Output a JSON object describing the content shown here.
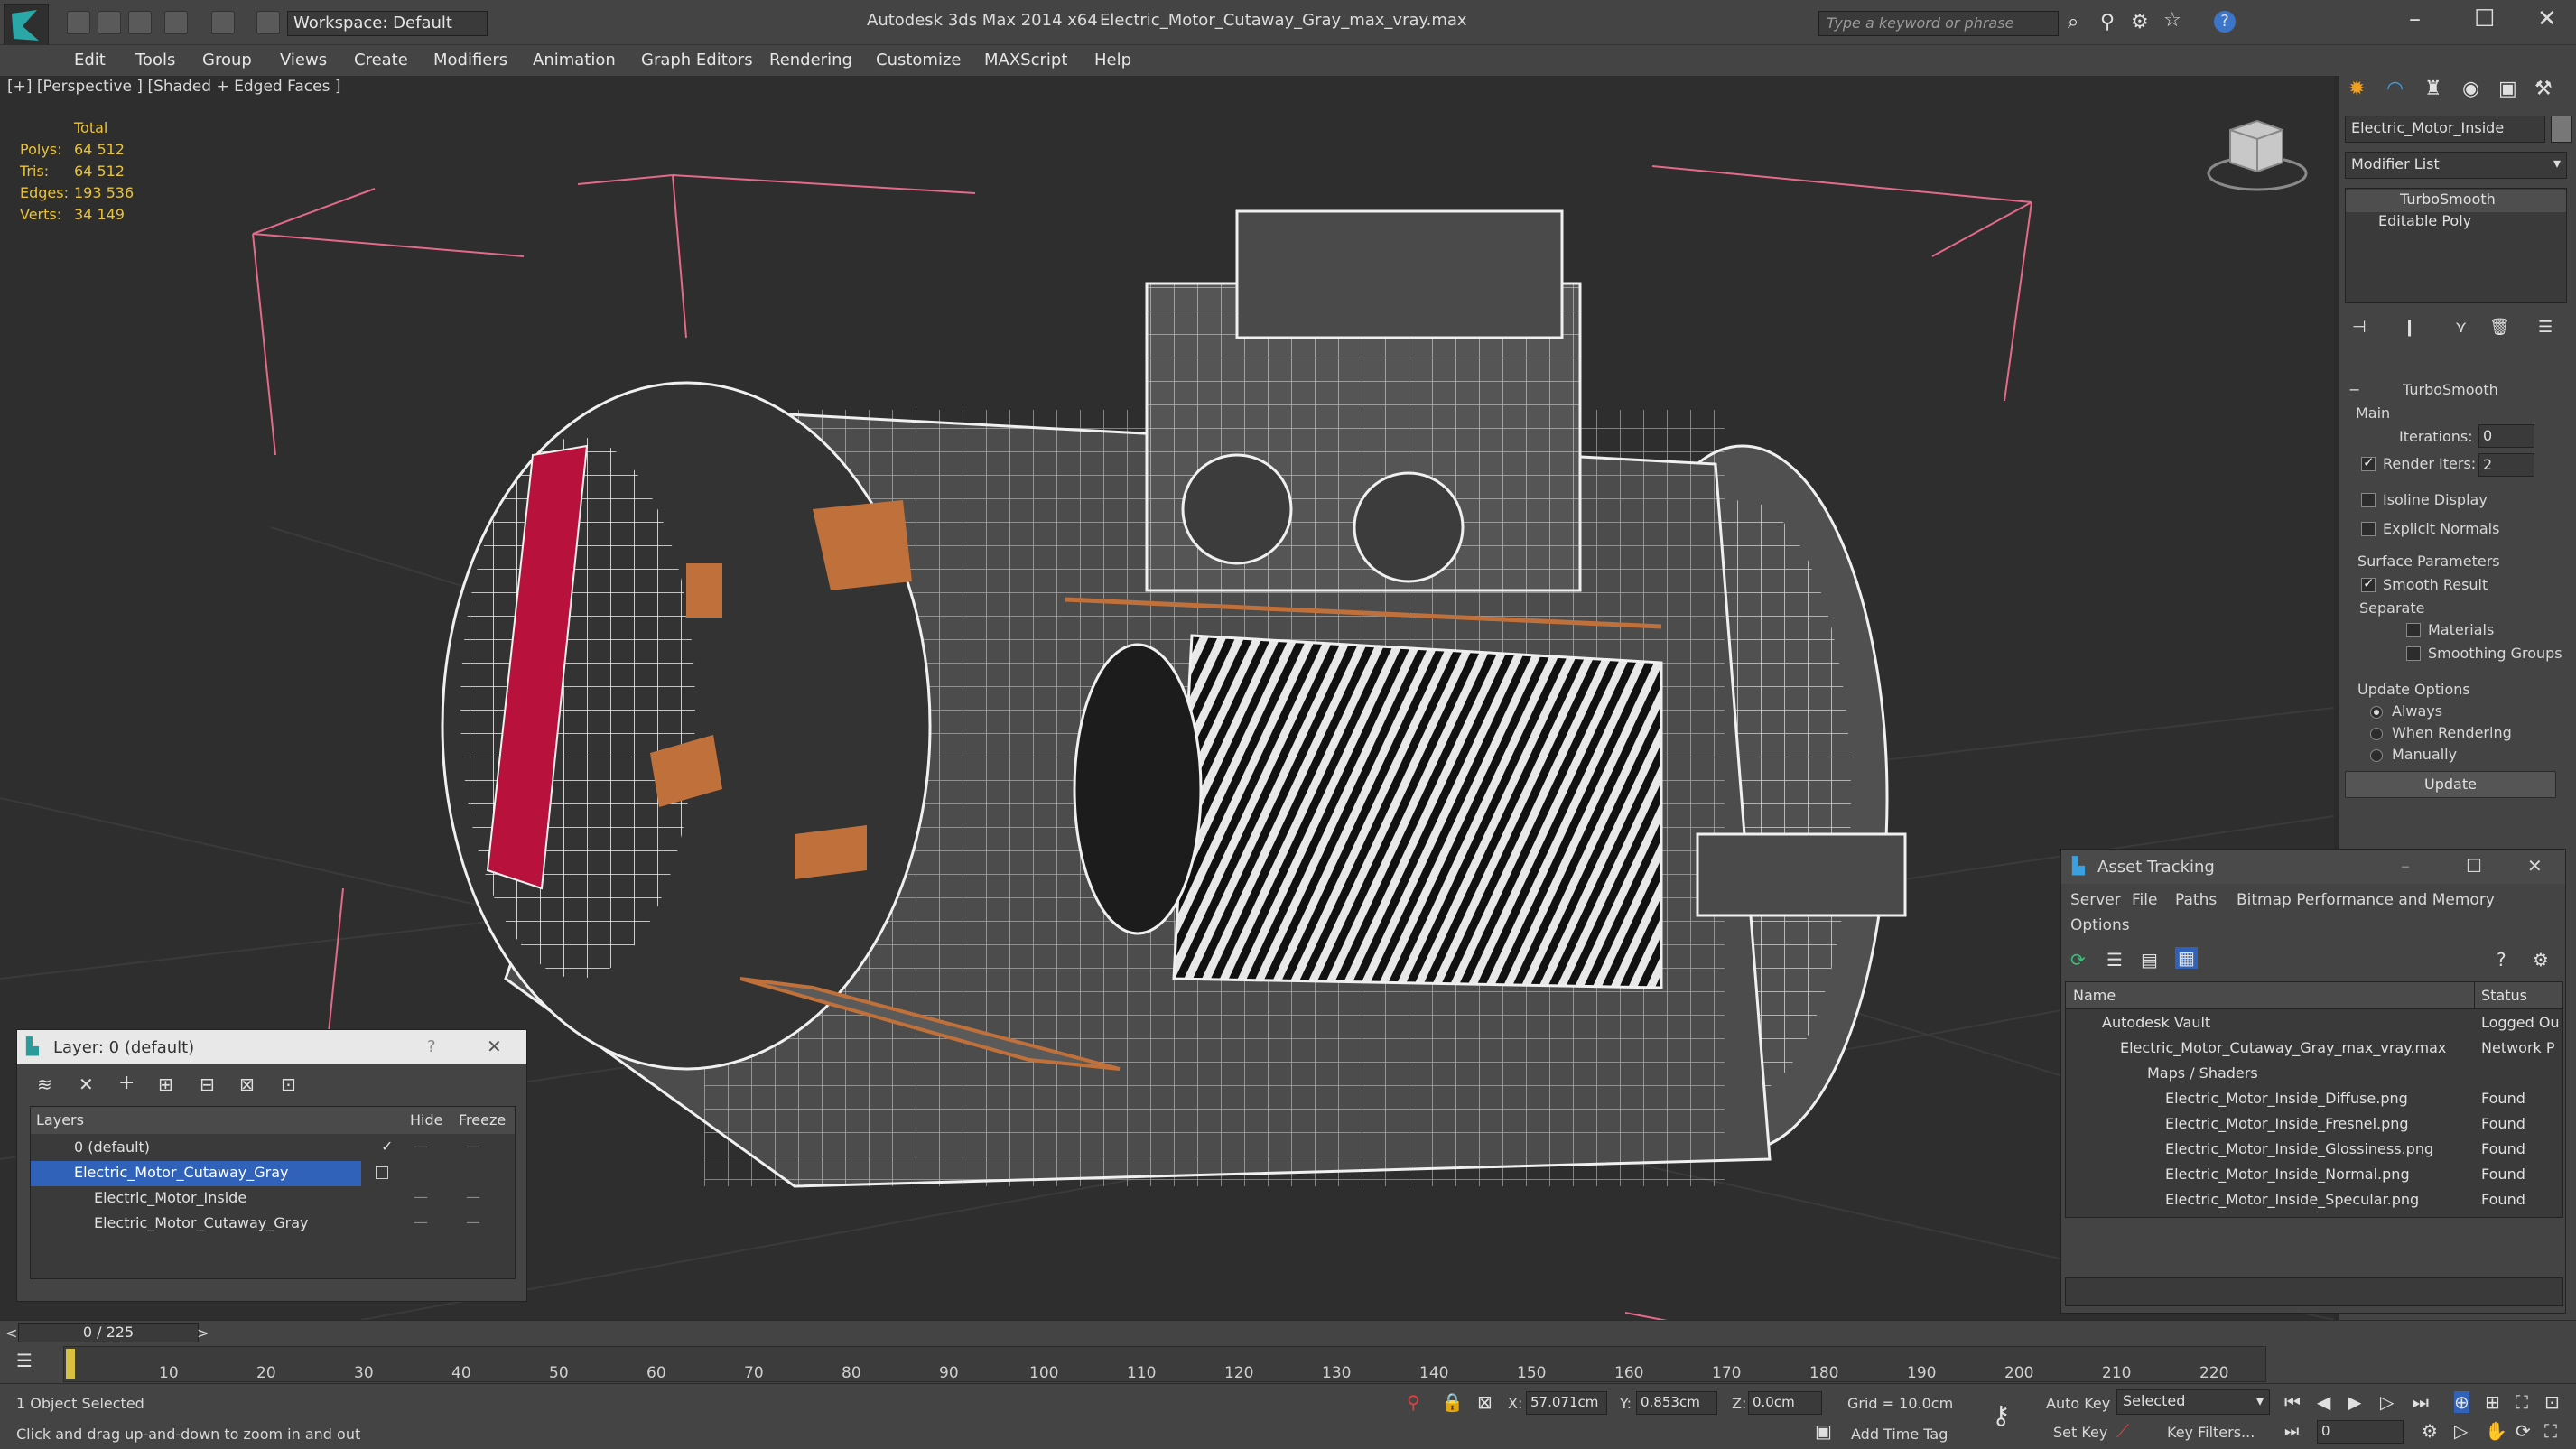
{
  "app": {
    "title": "Autodesk 3ds Max  2014 x64",
    "file": "Electric_Motor_Cutaway_Gray_max_vray.max",
    "workspace": "Workspace: Default",
    "search_placeholder": "Type a keyword or phrase",
    "help_icon": "?"
  },
  "menu": [
    "Edit",
    "Tools",
    "Group",
    "Views",
    "Create",
    "Modifiers",
    "Animation",
    "Graph Editors",
    "Rendering",
    "Customize",
    "MAXScript",
    "Help"
  ],
  "viewport": {
    "label": "[+] [Perspective ] [Shaded + Edged Faces ]",
    "stats_header": "Total",
    "stats": [
      {
        "k": "Polys:",
        "v": "64 512"
      },
      {
        "k": "Tris:",
        "v": "64 512"
      },
      {
        "k": "Edges:",
        "v": "193 536"
      },
      {
        "k": "Verts:",
        "v": "34 149"
      }
    ]
  },
  "command_panel": {
    "object_name": "Electric_Motor_Inside",
    "modifier_list": "Modifier List",
    "stack": [
      "TurboSmooth",
      "Editable Poly"
    ],
    "rollout_title": "TurboSmooth",
    "main_label": "Main",
    "iterations_label": "Iterations:",
    "iterations_value": "0",
    "render_iters_label": "Render Iters:",
    "render_iters_value": "2",
    "isoline": "Isoline Display",
    "explicit_normals": "Explicit Normals",
    "surface_params": "Surface Parameters",
    "smooth_result": "Smooth Result",
    "separate": "Separate",
    "materials": "Materials",
    "smoothing_groups": "Smoothing Groups",
    "update_options": "Update Options",
    "always": "Always",
    "when_rendering": "When Rendering",
    "manually": "Manually",
    "update_btn": "Update"
  },
  "layer_window": {
    "title": "Layer: 0 (default)",
    "help": "?",
    "col_layers": "Layers",
    "col_hide": "Hide",
    "col_freeze": "Freeze",
    "rows": [
      {
        "name": "0 (default)"
      },
      {
        "name": "Electric_Motor_Cutaway_Gray"
      },
      {
        "name": "Electric_Motor_Inside"
      },
      {
        "name": "Electric_Motor_Cutaway_Gray"
      }
    ]
  },
  "asset_window": {
    "title": "Asset Tracking",
    "menu": [
      "Server",
      "File",
      "Paths",
      "Bitmap Performance and Memory"
    ],
    "menu2": "Options",
    "col_name": "Name",
    "col_status": "Status",
    "rows": [
      {
        "name": "Autodesk Vault",
        "status": "Logged Ou"
      },
      {
        "name": "Electric_Motor_Cutaway_Gray_max_vray.max",
        "status": "Network P"
      },
      {
        "name": "Maps / Shaders",
        "status": ""
      },
      {
        "name": "Electric_Motor_Inside_Diffuse.png",
        "status": "Found"
      },
      {
        "name": "Electric_Motor_Inside_Fresnel.png",
        "status": "Found"
      },
      {
        "name": "Electric_Motor_Inside_Glossiness.png",
        "status": "Found"
      },
      {
        "name": "Electric_Motor_Inside_Normal.png",
        "status": "Found"
      },
      {
        "name": "Electric_Motor_Inside_Specular.png",
        "status": "Found"
      }
    ]
  },
  "timeline": {
    "frame": "0 / 225",
    "ticks": [
      "10",
      "20",
      "30",
      "40",
      "50",
      "60",
      "70",
      "80",
      "90",
      "100",
      "110",
      "120",
      "130",
      "140",
      "150",
      "160",
      "170",
      "180",
      "190",
      "200",
      "210",
      "220"
    ]
  },
  "status": {
    "selected": "1 Object Selected",
    "hint": "Click and drag up-and-down to zoom in and out",
    "x_label": "X:",
    "x_value": "57.071cm",
    "y_label": "Y:",
    "y_value": "0.853cm",
    "z_label": "Z:",
    "z_value": "0.0cm",
    "grid": "Grid = 10.0cm",
    "add_time_tag": "Add Time Tag",
    "auto_key": "Auto Key",
    "set_key": "Set Key",
    "selected_dropdown": "Selected",
    "key_filters": "Key Filters...",
    "frame_field": "0"
  },
  "colors": {
    "accent": "#2f62b8",
    "stats": "#e8c23a",
    "copper": "#c0703a",
    "red_part": "#b8123c"
  }
}
